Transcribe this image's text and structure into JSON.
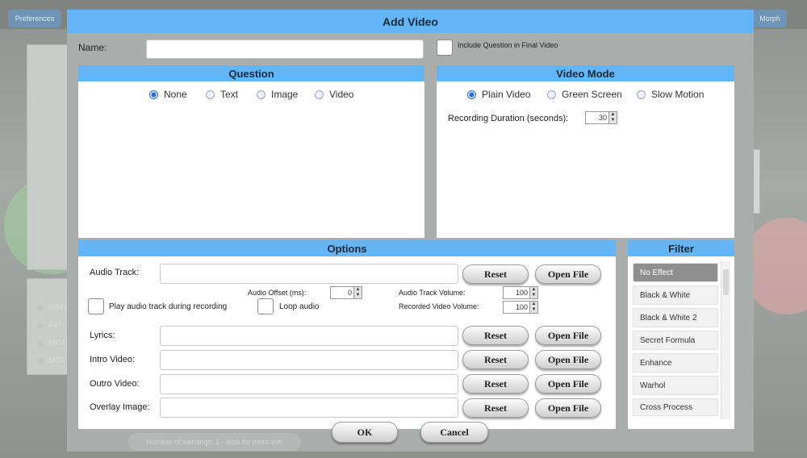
{
  "background": {
    "preferences_label": "Preferences",
    "morph_label": "Morph",
    "formats": [
      "WMV",
      "AVI",
      "MP4",
      "MOV"
    ]
  },
  "dialog": {
    "title": "Add Video",
    "name_label": "Name:",
    "name_value": "",
    "include_question_label": "Include Question in Final Video",
    "include_question_checked": false
  },
  "question": {
    "header": "Question",
    "options": [
      "None",
      "Text",
      "Image",
      "Video"
    ],
    "selected": "None"
  },
  "video_mode": {
    "header": "Video Mode",
    "options": [
      "Plain Video",
      "Green Screen",
      "Slow Motion"
    ],
    "selected": "Plain Video",
    "duration_label": "Recording Duration (seconds):",
    "duration_value": "30"
  },
  "options": {
    "header": "Options",
    "audio_track_label": "Audio Track:",
    "audio_offset_label": "Audio Offset (ms):",
    "audio_offset_value": "0",
    "audio_track_volume_label": "Audio Track Volume:",
    "audio_track_volume_value": "100",
    "recorded_volume_label": "Recorded Video Volume:",
    "recorded_volume_value": "100",
    "play_during_recording_label": "Play audio track during recording",
    "loop_audio_label": "Loop audio",
    "lyrics_label": "Lyrics:",
    "intro_label": "Intro Video:",
    "outro_label": "Outro Video:",
    "overlay_label": "Overlay Image:",
    "reset_label": "Reset",
    "open_file_label": "Open File"
  },
  "filter": {
    "header": "Filter",
    "items": [
      "No Effect",
      "Black & White",
      "Black & White 2",
      "Secret Formula",
      "Enhance",
      "Warhol",
      "Cross Process"
    ],
    "selected": "No Effect"
  },
  "footer": {
    "ok_label": "OK",
    "cancel_label": "Cancel",
    "warnings_text": "Number of warnings: 1 - click for more info"
  },
  "colors": {
    "header_blue": "#64b5f6",
    "selected_radio": "#2a6fd6"
  }
}
